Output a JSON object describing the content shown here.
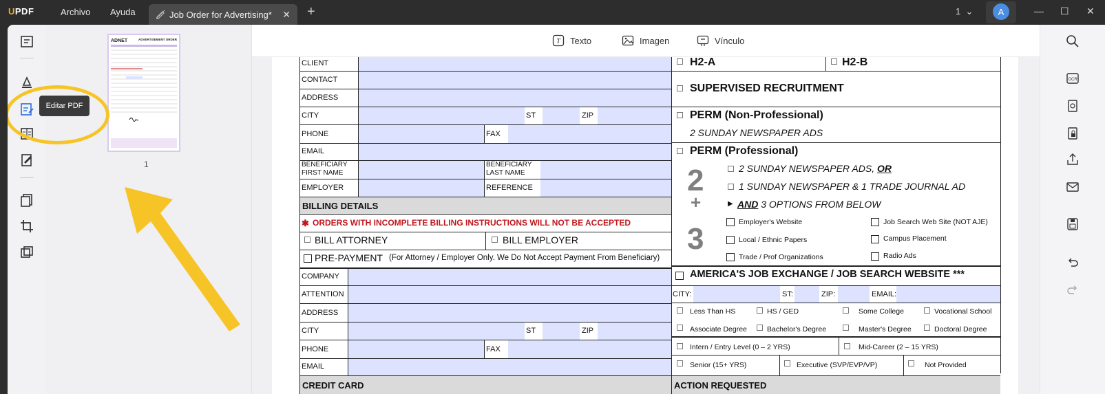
{
  "app": {
    "logo_u": "U",
    "logo_rest": "PDF"
  },
  "menu": {
    "file": "Archivo",
    "help": "Ayuda"
  },
  "tab": {
    "title": "Job Order for Advertising*"
  },
  "page_selector": {
    "value": "1"
  },
  "user": {
    "avatar_letter": "A"
  },
  "tooltip": {
    "text": "Editar PDF"
  },
  "thumbnails": {
    "page_number": "1",
    "thumb_brand": "ADNET",
    "thumb_title": "ADVERTISEMENT ORDER"
  },
  "toolbar": {
    "text": "Texto",
    "image": "Imagen",
    "link": "Vínculo"
  },
  "form": {
    "client": "CLIENT",
    "contact": "CONTACT",
    "address": "ADDRESS",
    "city": "CITY",
    "st": "ST",
    "zip": "ZIP",
    "phone": "PHONE",
    "fax": "FAX",
    "email": "EMAIL",
    "beneficiary_first_1": "BENEFICIARY",
    "beneficiary_first_2": "FIRST NAME",
    "beneficiary_last_1": "BENEFICIARY",
    "beneficiary_last_2": "LAST NAME",
    "employer": "EMPLOYER",
    "reference": "REFERENCE",
    "billing_details": "BILLING DETAILS",
    "billing_warning": "ORDERS WITH INCOMPLETE BILLING INSTRUCTIONS WILL NOT BE ACCEPTED",
    "billing_star": "✱",
    "bill_attorney": "BILL ATTORNEY",
    "bill_employer": "BILL EMPLOYER",
    "prepayment": "PRE-PAYMENT",
    "prepayment_note": "(For Attorney / Employer Only. We Do Not Accept Payment From Beneficiary)",
    "company": "COMPANY",
    "attention": "ATTENTION",
    "address2": "ADDRESS",
    "city2": "CITY",
    "st2": "ST",
    "zip2": "ZIP",
    "phone2": "PHONE",
    "fax2": "FAX",
    "email2": "EMAIL",
    "credit_card": "CREDIT CARD",
    "h2a": "H2-A",
    "h2b": "H2-B",
    "supervised": "SUPERVISED RECRUITMENT",
    "perm_nonpro": "PERM (Non-Professional)",
    "perm_nonpro_sub": "2 SUNDAY NEWSPAPER ADS",
    "perm_pro": "PERM (Professional)",
    "opt1_a": "2 SUNDAY NEWSPAPER ADS, ",
    "opt1_b": "OR",
    "opt2": "1 SUNDAY NEWSPAPER & 1 TRADE JOURNAL AD",
    "opt3_arrow": "▶",
    "opt3_a": "AND",
    "opt3_b": " 3 OPTIONS FROM BELOW",
    "num2": "2",
    "numplus": "+",
    "num3": "3",
    "employers_website": "Employer's Website",
    "job_search_web": "Job Search Web Site (NOT AJE)",
    "local_ethnic": "Local / Ethnic Papers",
    "campus": "Campus Placement",
    "trade_prof": "Trade / Prof Organizations",
    "radio": "Radio Ads",
    "aje": "AMERICA'S JOB EXCHANGE / JOB SEARCH WEBSITE ***",
    "aje_city": "CITY:",
    "aje_st": "ST:",
    "aje_zip": "ZIP:",
    "aje_email": "EMAIL:",
    "less_hs": "Less Than HS",
    "hs_ged": "HS / GED",
    "some_college": "Some College",
    "vocational": "Vocational School",
    "associate": "Associate Degree",
    "bachelor": "Bachelor's Degree",
    "master": "Master's Degree",
    "doctoral": "Doctoral Degree",
    "intern": "Intern / Entry Level (0 – 2 YRS)",
    "mid": "Mid-Career (2 – 15 YRS)",
    "senior": "Senior (15+ YRS)",
    "executive": "Executive (SVP/EVP/VP)",
    "not_provided": "Not Provided",
    "action_requested": "ACTION REQUESTED"
  },
  "colors": {
    "field_fill": "#dde3ff",
    "highlight": "#f7c427",
    "warning_red": "#c0171d"
  }
}
